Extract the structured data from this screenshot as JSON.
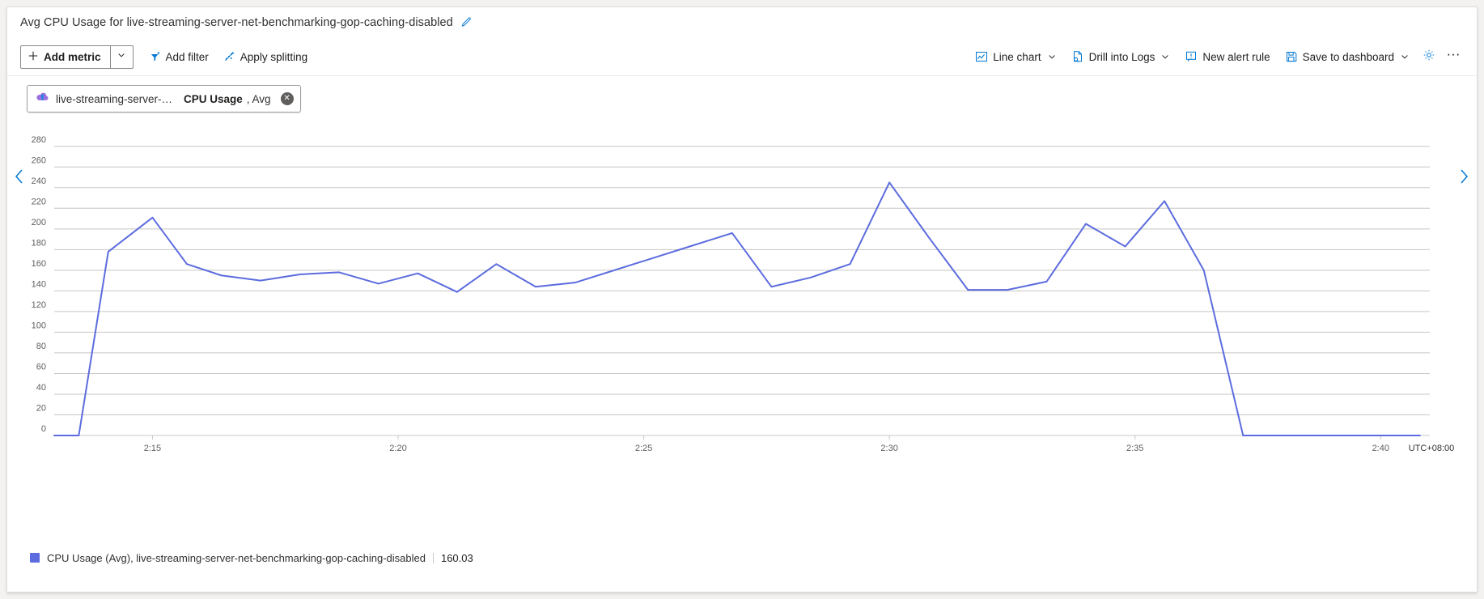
{
  "header": {
    "chart_title": "Avg CPU Usage for live-streaming-server-net-benchmarking-gop-caching-disabled",
    "edit_icon": "pencil-icon"
  },
  "toolbar": {
    "add_metric_label": "Add metric",
    "add_metric_icon": "plus-icon",
    "add_metric_caret_icon": "chevron-down-icon",
    "add_filter_label": "Add filter",
    "add_filter_icon": "filter-icon",
    "apply_splitting_label": "Apply splitting",
    "apply_splitting_icon": "splitting-icon",
    "line_chart_label": "Line chart",
    "line_chart_icon": "line-chart-icon",
    "drill_into_logs_label": "Drill into Logs",
    "drill_into_logs_icon": "logs-icon",
    "new_alert_rule_label": "New alert rule",
    "new_alert_rule_icon": "alert-icon",
    "save_to_dashboard_label": "Save to dashboard",
    "save_to_dashboard_icon": "save-icon",
    "settings_icon": "gear-icon",
    "more_label": "···",
    "more_icon": "ellipsis-icon"
  },
  "metric_chip": {
    "resource_icon": "azure-media-services-icon",
    "resource": "live-streaming-server-net-...",
    "metric": "CPU Usage",
    "aggregation": ", Avg",
    "close_icon": "close-icon",
    "close_glyph": "✕"
  },
  "navigation": {
    "prev_icon": "chevron-left-icon",
    "next_icon": "chevron-right-icon"
  },
  "legend": {
    "swatch_color": "#5c6cde",
    "label": "CPU Usage (Avg), live-streaming-server-net-benchmarking-gop-caching-disabled",
    "value": "160.03"
  },
  "chart_data": {
    "type": "line",
    "title": "Avg CPU Usage for live-streaming-server-net-benchmarking-gop-caching-disabled",
    "xlabel": "",
    "ylabel": "",
    "timezone_label": "UTC+08:00",
    "grid": true,
    "legend_position": "bottom",
    "line_color": "#5c6cde",
    "ylim": [
      0,
      290
    ],
    "ytick_values": [
      0,
      20,
      40,
      60,
      80,
      100,
      120,
      140,
      160,
      180,
      200,
      220,
      240,
      260,
      280
    ],
    "ytick_labels": [
      "0",
      "20",
      "40",
      "60",
      "80",
      "100",
      "120",
      "140",
      "160",
      "180",
      "200",
      "220",
      "240",
      "260",
      "280"
    ],
    "xtick_labels": [
      "2:15",
      "2:20",
      "2:25",
      "2:30",
      "2:35",
      "2:40"
    ],
    "xtick_positions": [
      2.0,
      7.0,
      12.0,
      17.0,
      22.0,
      27.0
    ],
    "xlim": [
      0,
      28
    ],
    "series": [
      {
        "name": "CPU Usage (Avg), live-streaming-server-net-benchmarking-gop-caching-disabled",
        "x": [
          0.0,
          0.5,
          1.1,
          2.0,
          2.7,
          3.4,
          4.2,
          5.0,
          5.8,
          6.6,
          7.4,
          8.2,
          9.0,
          9.8,
          10.6,
          11.4,
          12.2,
          13.0,
          13.8,
          14.6,
          15.4,
          16.2,
          17.0,
          17.8,
          18.6,
          19.4,
          20.2,
          21.0,
          21.8,
          22.6,
          23.4,
          24.2,
          25.0,
          25.8,
          26.6,
          27.3,
          27.8
        ],
        "y": [
          0,
          0,
          178,
          211,
          166,
          155,
          150,
          156,
          158,
          147,
          157,
          139,
          166,
          144,
          148,
          160,
          172,
          184,
          196,
          144,
          153,
          166,
          245,
          192,
          141,
          141,
          149,
          205,
          183,
          227,
          160.03,
          0,
          0,
          0,
          0,
          0,
          0
        ],
        "values_note": "CPU percentage over time"
      }
    ]
  }
}
